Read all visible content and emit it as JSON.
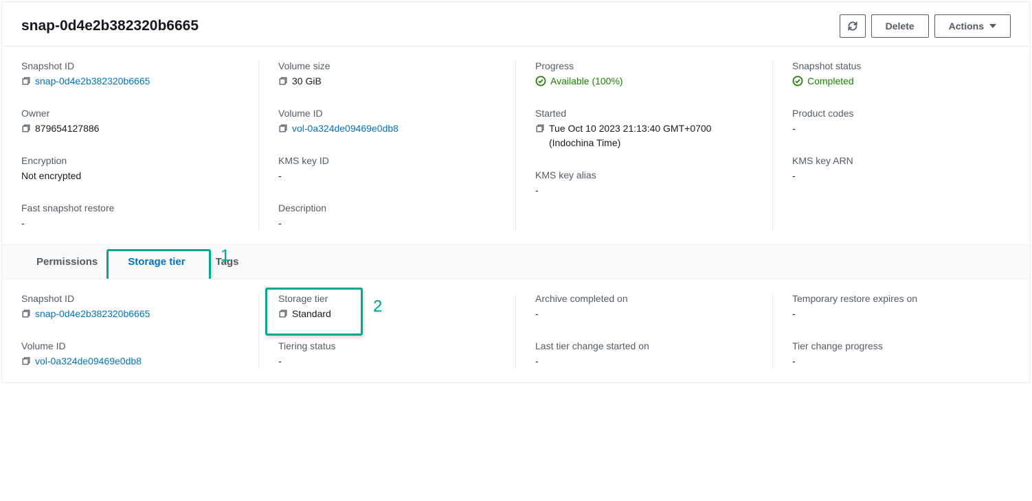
{
  "header": {
    "title": "snap-0d4e2b382320b6665",
    "delete_label": "Delete",
    "actions_label": "Actions"
  },
  "details": {
    "col1": {
      "snapshot_id_label": "Snapshot ID",
      "snapshot_id": "snap-0d4e2b382320b6665",
      "owner_label": "Owner",
      "owner": "879654127886",
      "encryption_label": "Encryption",
      "encryption": "Not encrypted",
      "fsr_label": "Fast snapshot restore",
      "fsr": "-"
    },
    "col2": {
      "volume_size_label": "Volume size",
      "volume_size": "30 GiB",
      "volume_id_label": "Volume ID",
      "volume_id": "vol-0a324de09469e0db8",
      "kms_key_id_label": "KMS key ID",
      "kms_key_id": "-",
      "description_label": "Description",
      "description": "-"
    },
    "col3": {
      "progress_label": "Progress",
      "progress": "Available (100%)",
      "started_label": "Started",
      "started": "Tue Oct 10 2023 21:13:40 GMT+0700 (Indochina Time)",
      "kms_key_alias_label": "KMS key alias",
      "kms_key_alias": "-"
    },
    "col4": {
      "status_label": "Snapshot status",
      "status": "Completed",
      "product_codes_label": "Product codes",
      "product_codes": "-",
      "kms_key_arn_label": "KMS key ARN",
      "kms_key_arn": "-"
    }
  },
  "tabs": {
    "permissions": "Permissions",
    "storage_tier": "Storage tier",
    "tags": "Tags"
  },
  "tier": {
    "col1": {
      "snapshot_id_label": "Snapshot ID",
      "snapshot_id": "snap-0d4e2b382320b6665",
      "volume_id_label": "Volume ID",
      "volume_id": "vol-0a324de09469e0db8"
    },
    "col2": {
      "storage_tier_label": "Storage tier",
      "storage_tier": "Standard",
      "tiering_status_label": "Tiering status",
      "tiering_status": "-"
    },
    "col3": {
      "archive_completed_label": "Archive completed on",
      "archive_completed": "-",
      "last_tier_change_label": "Last tier change started on",
      "last_tier_change": "-"
    },
    "col4": {
      "restore_expires_label": "Temporary restore expires on",
      "restore_expires": "-",
      "tier_progress_label": "Tier change progress",
      "tier_progress": "-"
    }
  },
  "callouts": {
    "one": "1",
    "two": "2"
  }
}
